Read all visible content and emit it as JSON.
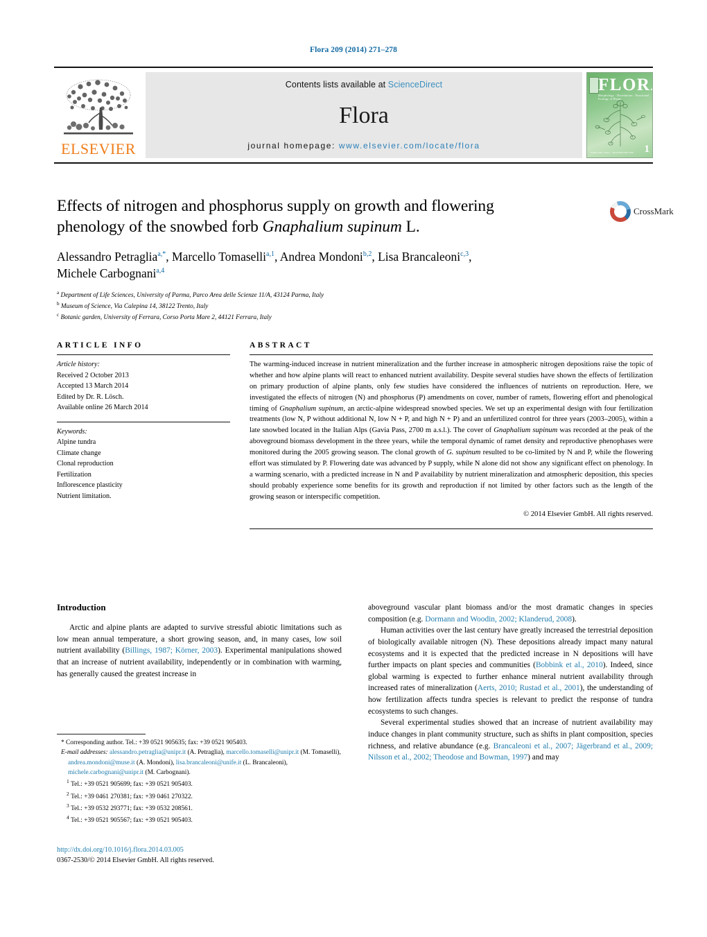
{
  "running_head": "Flora 209 (2014) 271–278",
  "masthead": {
    "elsevier_wordmark": "ELSEVIER",
    "contents_prefix": "Contents lists available at ",
    "contents_link": "ScienceDirect",
    "journal_name": "Flora",
    "homepage_prefix": "journal homepage: ",
    "homepage_url": "www.elsevier.com/locate/flora",
    "cover": {
      "title": "FLORA",
      "subtitle": "Morphology · Distribution · Functional Ecology of Plants",
      "issue_number": "1",
      "footer_left": "Volume 209 · Issue 1 · 2014",
      "footer_right": "ISSN 0367-2530"
    }
  },
  "article": {
    "title_line1": "Effects of nitrogen and phosphorus supply on growth and flowering",
    "title_line2_pre": "phenology of the snowbed forb ",
    "title_species": "Gnaphalium supinum",
    "title_line2_post": " L.",
    "authors": [
      {
        "name": "Alessandro Petraglia",
        "marks": "a,*"
      },
      {
        "name": "Marcello Tomaselli",
        "marks": "a,1"
      },
      {
        "name": "Andrea Mondoni",
        "marks": "b,2"
      },
      {
        "name": "Lisa Brancaleoni",
        "marks": "c,3"
      },
      {
        "name": "Michele Carbognani",
        "marks": "a,4"
      }
    ],
    "affiliations": [
      {
        "mark": "a",
        "text": "Department of Life Sciences, University of Parma, Parco Area delle Scienze 11/A, 43124 Parma, Italy"
      },
      {
        "mark": "b",
        "text": "Museum of Science, Via Calepina 14, 38122 Trento, Italy"
      },
      {
        "mark": "c",
        "text": "Botanic garden, University of Ferrara, Corso Porta Mare 2, 44121 Ferrara, Italy"
      }
    ],
    "crossmark_label": "CrossMark"
  },
  "article_info": {
    "heading": "ARTICLE INFO",
    "history_label": "Article history:",
    "history": [
      "Received 2 October 2013",
      "Accepted 13 March 2014",
      "Edited by Dr. R. Lösch.",
      "Available online 26 March 2014"
    ],
    "keywords_label": "Keywords:",
    "keywords": [
      "Alpine tundra",
      "Climate change",
      "Clonal reproduction",
      "Fertilization",
      "Inflorescence plasticity",
      "Nutrient limitation."
    ]
  },
  "abstract": {
    "heading": "ABSTRACT",
    "part1": "The warming-induced increase in nutrient mineralization and the further increase in atmospheric nitrogen depositions raise the topic of whether and how alpine plants will react to enhanced nutrient availability. Despite several studies have shown the effects of fertilization on primary production of alpine plants, only few studies have considered the influences of nutrients on reproduction. Here, we investigated the effects of nitrogen (N) and phosphorus (P) amendments on cover, number of ramets, flowering effort and phenological timing of ",
    "species1": "Gnaphalium supinum",
    "part2": ", an arctic-alpine widespread snowbed species. We set up an experimental design with four fertilization treatments (low N, P without additional N, low N + P, and high N + P) and an unfertilized control for three years (2003–2005), within a late snowbed located in the Italian Alps (Gavia Pass, 2700 m a.s.l.). The cover of ",
    "species2": "Gnaphalium supinum",
    "part3": " was recorded at the peak of the aboveground biomass development in the three years, while the temporal dynamic of ramet density and reproductive phenophases were monitored during the 2005 growing season. The clonal growth of ",
    "species3": "G. supinum",
    "part4": " resulted to be co-limited by N and P, while the flowering effort was stimulated by P. Flowering date was advanced by P supply, while N alone did not show any significant effect on phenology. In a warming scenario, with a predicted increase in N and P availability by nutrient mineralization and atmospheric deposition, this species should probably experience some benefits for its growth and reproduction if not limited by other factors such as the length of the growing season or interspecific competition.",
    "copyright": "© 2014 Elsevier GmbH. All rights reserved."
  },
  "body": {
    "section_title": "Introduction",
    "left_p1_a": "Arctic and alpine plants are adapted to survive stressful abiotic limitations such as low mean annual temperature, a short growing season, and, in many cases, low soil nutrient availability (",
    "left_p1_ref1": "Billings, 1987; Körner, 2003",
    "left_p1_b": "). Experimental manipulations showed that an increase of nutrient availability, independently or in combination with warming, has generally caused the greatest increase in",
    "right_p1_a": "aboveground vascular plant biomass and/or the most dramatic changes in species composition (e.g. ",
    "right_p1_ref": "Dormann and Woodin, 2002; Klanderud, 2008",
    "right_p1_b": ").",
    "right_p2_a": "Human activities over the last century have greatly increased the terrestrial deposition of biologically available nitrogen (N). These depositions already impact many natural ecosystems and it is expected that the predicted increase in N depositions will have further impacts on plant species and communities (",
    "right_p2_ref1": "Bobbink et al., 2010",
    "right_p2_b": "). Indeed, since global warming is expected to further enhance mineral nutrient availability through increased rates of mineralization (",
    "right_p2_ref2": "Aerts, 2010; Rustad et al., 2001",
    "right_p2_c": "), the understanding of how fertilization affects tundra species is relevant to predict the response of tundra ecosystems to such changes.",
    "right_p3_a": "Several experimental studies showed that an increase of nutrient availability may induce changes in plant community structure, such as shifts in plant composition, species richness, and relative abundance (e.g. ",
    "right_p3_ref": "Brancaleoni et al., 2007; Jägerbrand et al., 2009; Nilsson et al., 2002; Theodose and Bowman, 1997",
    "right_p3_b": ") and may"
  },
  "footnotes": {
    "corresponding": "Corresponding author. Tel.: +39 0521 905635; fax: +39 0521 905403.",
    "email_label": "E-mail addresses:",
    "emails": [
      {
        "addr": "alessandro.petraglia@unipr.it",
        "who": " (A. Petraglia),"
      },
      {
        "addr": "marcello.tomaselli@unipr.it",
        "who": " (M. Tomaselli),"
      },
      {
        "addr": "andrea.mondoni@muse.it",
        "who": " (A. Mondoni),"
      },
      {
        "addr": "lisa.brancaleoni@unife.it",
        "who": " (L. Brancaleoni),"
      },
      {
        "addr": "michele.carbognani@unipr.it",
        "who": " (M. Carbognani)."
      }
    ],
    "numbered": [
      {
        "num": "1",
        "text": "Tel.: +39 0521 905699; fax: +39 0521 905403."
      },
      {
        "num": "2",
        "text": "Tel.: +39 0461 270381; fax: +39 0461 270322."
      },
      {
        "num": "3",
        "text": "Tel.: +39 0532 293771; fax: +39 0532 208561."
      },
      {
        "num": "4",
        "text": "Tel.: +39 0521 905567; fax: +39 0521 905403."
      }
    ]
  },
  "doi_block": {
    "doi_url": "http://dx.doi.org/10.1016/j.flora.2014.03.005",
    "issn_line": "0367-2530/© 2014 Elsevier GmbH. All rights reserved."
  },
  "colors": {
    "link": "#1f7cad",
    "header_blue": "#1169a3",
    "elsevier_orange": "#ef7d1a",
    "band_gray": "#e7e7e7"
  }
}
